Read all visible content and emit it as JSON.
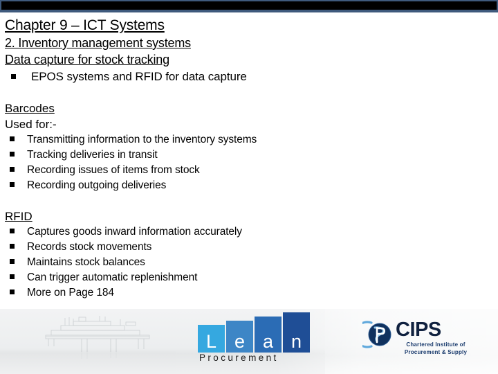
{
  "slide": {
    "title": "Chapter 9 – ICT Systems",
    "subtitle": "2. Inventory management systems",
    "subtitle2": "Data capture for stock tracking",
    "intro_bullet": "EPOS systems and RFID for data capture",
    "sections": [
      {
        "heading": "Barcodes",
        "lead": "Used for:-",
        "bullets": [
          "Transmitting information to the inventory systems",
          "Tracking deliveries in transit",
          "Recording issues of items from stock",
          "Recording outgoing deliveries"
        ]
      },
      {
        "heading": "RFID",
        "lead": "",
        "bullets": [
          "Captures goods inward information accurately",
          "Records stock movements",
          "Maintains stock balances",
          "Can trigger automatic replenishment",
          "More on Page 184"
        ]
      }
    ]
  },
  "footer": {
    "lean_logo": {
      "letters": [
        "L",
        "e",
        "a",
        "n"
      ],
      "word": "P r o c u r e m e n t",
      "word_plain": "Procurement",
      "colors": [
        "#35a8e0",
        "#3d86c6",
        "#2b6cb5",
        "#1f4e96"
      ]
    },
    "cips_logo": {
      "name": "CIPS",
      "tagline_line1": "Chartered Institute of",
      "tagline_line2": "Procurement & Supply",
      "mark_color": "#10315e",
      "swoosh_color": "#5fa8dc"
    },
    "photo_alt": "offshore oil platform"
  },
  "theme": {
    "bar_fill": "#000000",
    "bar_frame": "#3f5a7d",
    "text": "#000000",
    "background": "#ffffff"
  }
}
